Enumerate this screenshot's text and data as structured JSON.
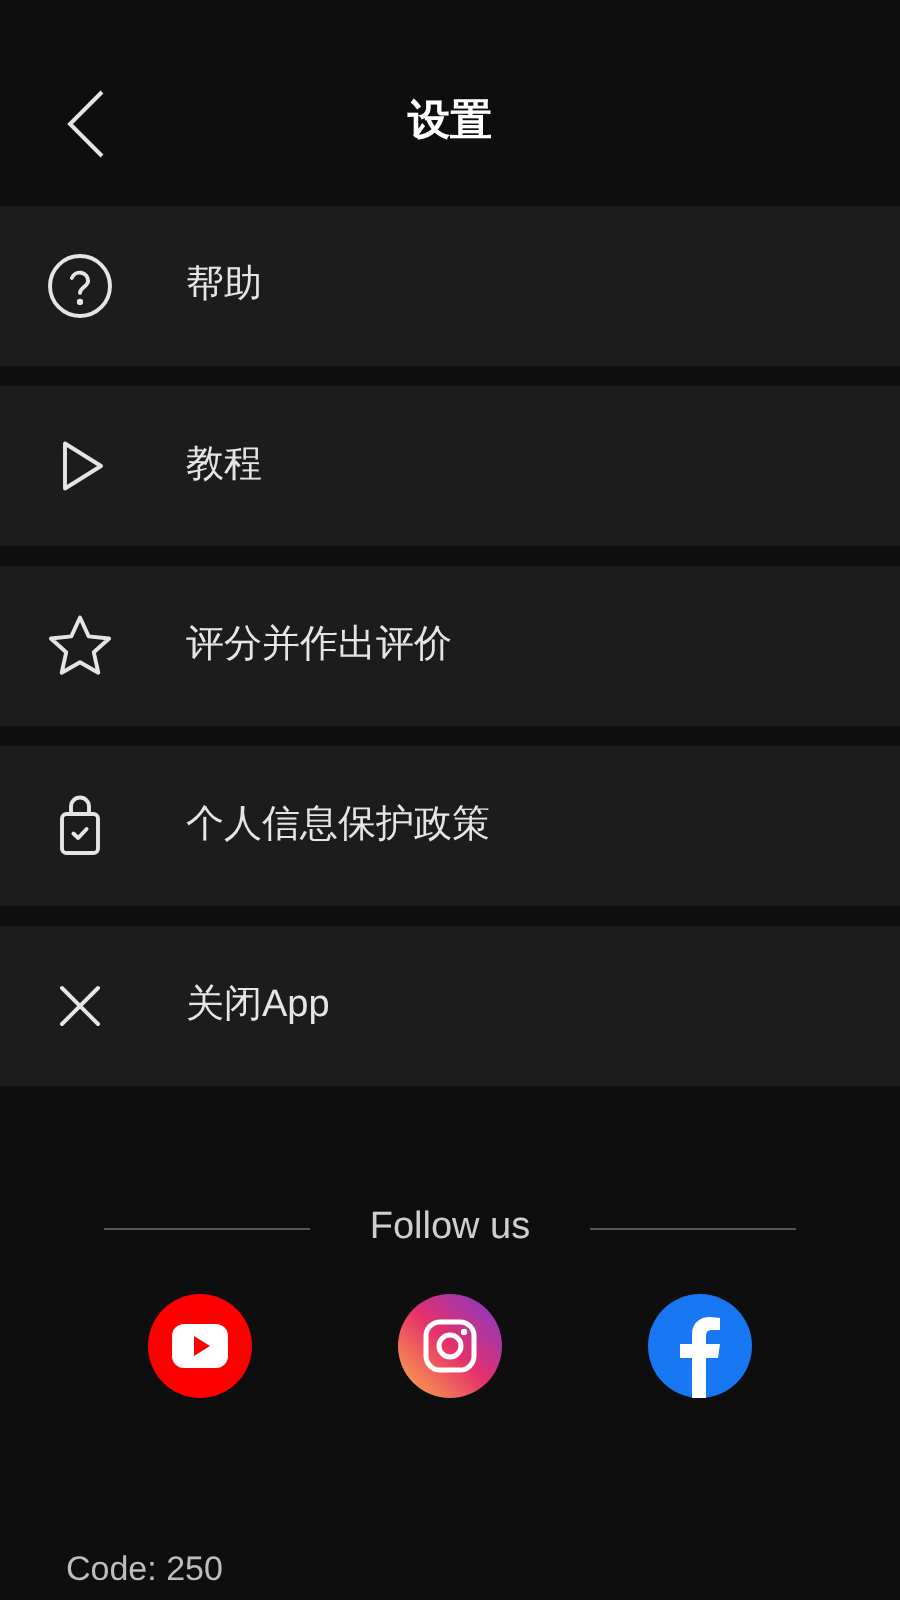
{
  "header": {
    "title": "设置"
  },
  "menu": [
    {
      "kind": "help",
      "label": "帮助"
    },
    {
      "kind": "play",
      "label": "教程"
    },
    {
      "kind": "star",
      "label": "评分并作出评价"
    },
    {
      "kind": "lock",
      "label": "个人信息保护政策"
    },
    {
      "kind": "close",
      "label": "关闭App"
    }
  ],
  "follow": {
    "label": "Follow us",
    "links": [
      {
        "kind": "youtube"
      },
      {
        "kind": "instagram"
      },
      {
        "kind": "facebook"
      }
    ]
  },
  "code": "Code: 250"
}
